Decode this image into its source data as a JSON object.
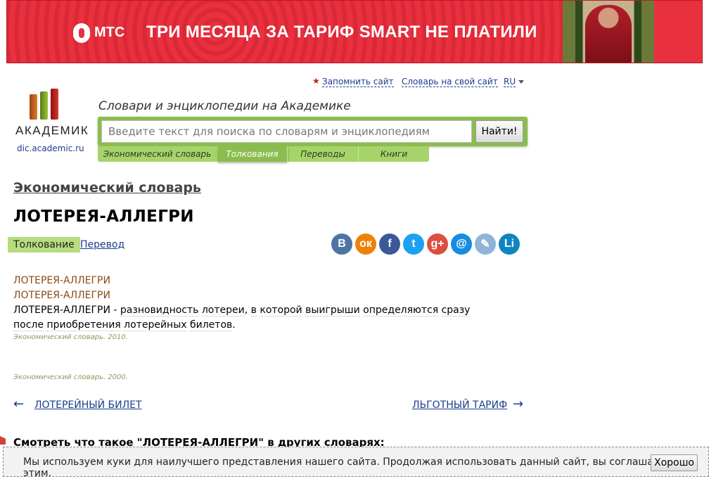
{
  "banner": {
    "brand": "МТС",
    "text": "ТРИ МЕСЯЦА ЗА ТАРИФ SMART НЕ ПЛАТИЛИ"
  },
  "logo": {
    "name": "АКАДЕМИК",
    "url": "dic.academic.ru"
  },
  "top_links": {
    "remember": "Запомнить сайт",
    "on_site": "Словарь на свой сайт",
    "lang": "RU"
  },
  "search": {
    "tagline": "Словари и энциклопедии на Академике",
    "placeholder": "Введите текст для поиска по словарям и энциклопедиям",
    "button": "Найти!",
    "tabs": [
      {
        "label": "Экономический словарь"
      },
      {
        "label": "Толкования"
      },
      {
        "label": "Переводы"
      },
      {
        "label": "Книги"
      }
    ]
  },
  "content": {
    "dictionary": "Экономический словарь",
    "title": "ЛОТЕРЕЯ-АЛЛЕГРИ",
    "tab_interpretation": "Толкование",
    "tab_translation": "Перевод",
    "headword1": "ЛОТЕРЕЯ-АЛЛЕГРИ",
    "headword2": "ЛОТЕРЕЯ-АЛЛЕГРИ",
    "definition_term": "ЛОТЕРЕЯ-АЛЛЕГРИ",
    "definition_dash": " - ",
    "definition_words": [
      "разновидность",
      "лотереи",
      "в",
      "которой",
      "выигрыши",
      "определяются",
      "сразу",
      "после",
      "приобретения",
      "лотерейных",
      "билетов"
    ],
    "source1": "Экономический словарь. 2010.",
    "source2": "Экономический словарь. 2000.",
    "prev": "ЛОТЕРЕЙНЫЙ БИЛЕТ",
    "next": "ЛЬГОТНЫЙ ТАРИФ",
    "see_also": "Смотреть что такое \"ЛОТЕРЕЯ-АЛЛЕГРИ\" в других словарях:"
  },
  "share_icons": [
    {
      "name": "vk-icon",
      "glyph": "В",
      "color": "#4c75a3"
    },
    {
      "name": "odnoklassniki-icon",
      "glyph": "ок",
      "color": "#ee8208"
    },
    {
      "name": "facebook-icon",
      "glyph": "f",
      "color": "#3b5998"
    },
    {
      "name": "twitter-icon",
      "glyph": "t",
      "color": "#1da1f2"
    },
    {
      "name": "google-plus-icon",
      "glyph": "g+",
      "color": "#dc4e41"
    },
    {
      "name": "mail-icon",
      "glyph": "@",
      "color": "#168de2"
    },
    {
      "name": "livejournal-icon",
      "glyph": "✎",
      "color": "#8fb4d8"
    },
    {
      "name": "liveinternet-icon",
      "glyph": "Li",
      "color": "#0f85c0"
    }
  ],
  "cookie": {
    "text": "Мы используем куки для наилучшего представления нашего сайта. Продолжая использовать данный сайт, вы соглашаетесь с этим.",
    "button": "Хорошо"
  }
}
